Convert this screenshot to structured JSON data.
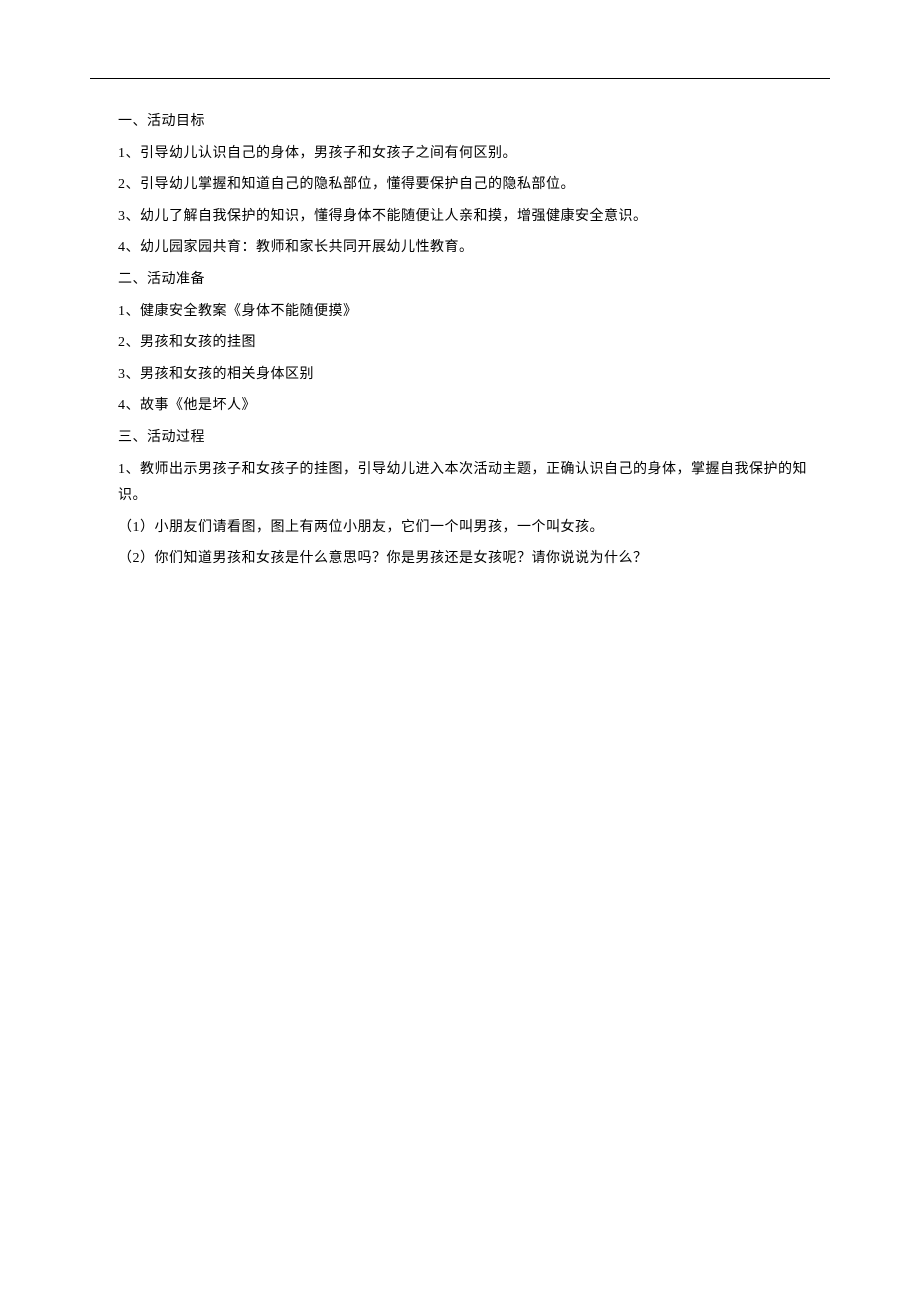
{
  "sections": {
    "s1": {
      "heading": "一、活动目标",
      "items": [
        "1、引导幼儿认识自己的身体，男孩子和女孩子之间有何区别。",
        "2、引导幼儿掌握和知道自己的隐私部位，懂得要保护自己的隐私部位。",
        "3、幼儿了解自我保护的知识，懂得身体不能随便让人亲和摸，增强健康安全意识。",
        "4、幼儿园家园共育：教师和家长共同开展幼儿性教育。"
      ]
    },
    "s2": {
      "heading": "二、活动准备",
      "items": [
        "1、健康安全教案《身体不能随便摸》",
        "2、男孩和女孩的挂图",
        "3、男孩和女孩的相关身体区别",
        "4、故事《他是坏人》"
      ]
    },
    "s3": {
      "heading": "三、活动过程",
      "items": [
        "1、教师出示男孩子和女孩子的挂图，引导幼儿进入本次活动主题，正确认识自己的身体，掌握自我保护的知识。"
      ],
      "subitems": [
        "（1）小朋友们请看图，图上有两位小朋友，它们一个叫男孩，一个叫女孩。",
        "（2）你们知道男孩和女孩是什么意思吗？你是男孩还是女孩呢？请你说说为什么？"
      ]
    }
  }
}
